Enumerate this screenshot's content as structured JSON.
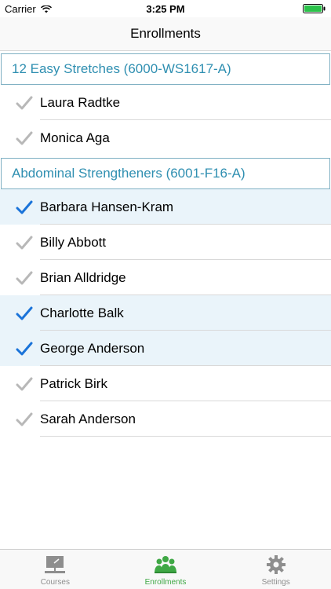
{
  "status_bar": {
    "carrier": "Carrier",
    "time": "3:25 PM",
    "icons": [
      "wifi-icon",
      "battery-icon"
    ]
  },
  "nav": {
    "title": "Enrollments"
  },
  "sections": [
    {
      "title": "12 Easy Stretches  (6000-WS1617-A)",
      "rows": [
        {
          "name": "Laura Radtke",
          "checked": false
        },
        {
          "name": "Monica Aga",
          "checked": false
        }
      ]
    },
    {
      "title": "Abdominal Strengtheners  (6001-F16-A)",
      "rows": [
        {
          "name": "Barbara Hansen-Kram",
          "checked": true
        },
        {
          "name": "Billy Abbott",
          "checked": false
        },
        {
          "name": "Brian Alldridge",
          "checked": false
        },
        {
          "name": "Charlotte Balk",
          "checked": true
        },
        {
          "name": "George Anderson",
          "checked": true
        },
        {
          "name": "Patrick Birk",
          "checked": false
        },
        {
          "name": "Sarah Anderson",
          "checked": false
        }
      ]
    }
  ],
  "tabs": [
    {
      "label": "Courses",
      "icon": "classroom-board-icon",
      "active": false
    },
    {
      "label": "Enrollments",
      "icon": "people-group-icon",
      "active": true
    },
    {
      "label": "Settings",
      "icon": "gear-icon",
      "active": false
    }
  ],
  "colors": {
    "section_text": "#2f8fb1",
    "section_border": "#7fb0c3",
    "check_active": "#1a73d9",
    "check_inactive": "#b8b8b8",
    "row_selected_bg": "#eaf4fa",
    "tab_active": "#3fa845",
    "tab_inactive": "#8e8e8e"
  }
}
